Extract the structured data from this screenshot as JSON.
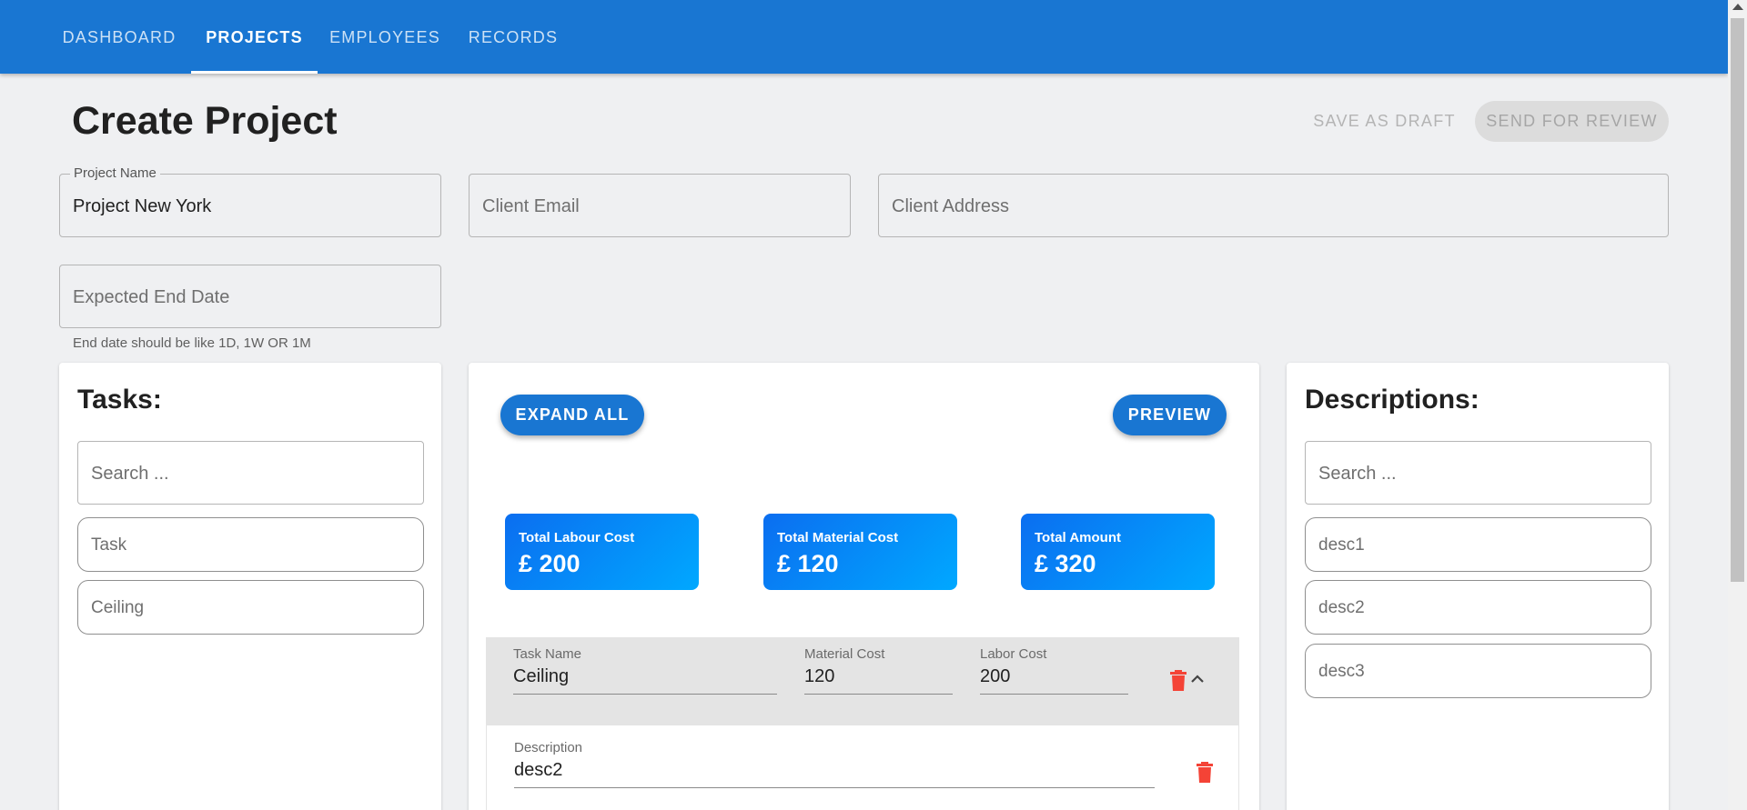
{
  "nav": {
    "tabs": [
      {
        "label": "DASHBOARD"
      },
      {
        "label": "PROJECTS"
      },
      {
        "label": "EMPLOYEES"
      },
      {
        "label": "RECORDS"
      }
    ],
    "active_tab": "PROJECTS"
  },
  "header": {
    "title": "Create Project",
    "save_draft_label": "SAVE AS DRAFT",
    "send_review_label": "SEND FOR REVIEW"
  },
  "form": {
    "project_name": {
      "label": "Project Name",
      "value": "Project New York"
    },
    "client_email": {
      "placeholder": "Client Email"
    },
    "client_address": {
      "placeholder": "Client Address"
    },
    "end_date": {
      "placeholder": "Expected End Date",
      "helper": "End date should be like 1D, 1W OR 1M"
    }
  },
  "tasks_panel": {
    "title": "Tasks:",
    "search_placeholder": "Search ...",
    "items": [
      {
        "label": "Task"
      },
      {
        "label": "Ceiling"
      }
    ]
  },
  "center": {
    "expand_all_label": "EXPAND ALL",
    "preview_label": "PREVIEW",
    "stats": [
      {
        "label": "Total Labour Cost",
        "amount": "£ 200"
      },
      {
        "label": "Total Material Cost",
        "amount": "£ 120"
      },
      {
        "label": "Total Amount",
        "amount": "£ 320"
      }
    ],
    "task": {
      "name_label": "Task Name",
      "name": "Ceiling",
      "material_label": "Material Cost",
      "material": "120",
      "labor_label": "Labor Cost",
      "labor": "200",
      "description_label": "Description",
      "description": "desc2"
    }
  },
  "descriptions_panel": {
    "title": "Descriptions:",
    "search_placeholder": "Search ...",
    "items": [
      {
        "label": "desc1"
      },
      {
        "label": "desc2"
      },
      {
        "label": "desc3"
      }
    ]
  },
  "colors": {
    "primary": "#1976d2",
    "danger": "#f44336",
    "background": "#eff0f2"
  }
}
